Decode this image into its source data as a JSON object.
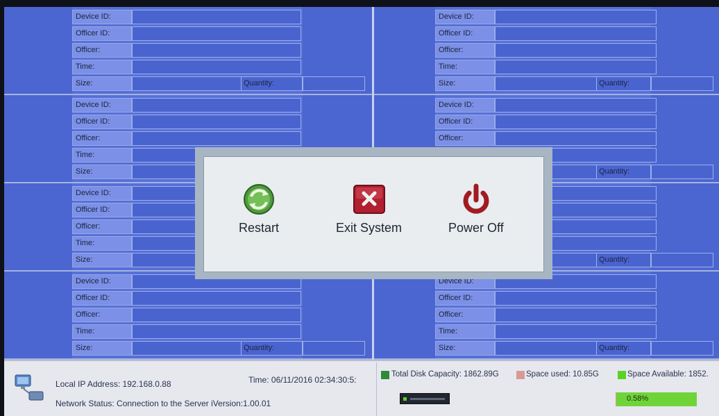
{
  "labels": {
    "device_id": "Device ID:",
    "officer_id": "Officer ID:",
    "officer": "Officer:",
    "time": "Time:",
    "size": "Size:",
    "quantity": "Quantity:"
  },
  "panels": [
    {
      "id": "slot-1"
    },
    {
      "id": "slot-2"
    },
    {
      "id": "slot-3"
    },
    {
      "id": "slot-4"
    },
    {
      "id": "slot-5"
    },
    {
      "id": "slot-6"
    },
    {
      "id": "slot-7"
    },
    {
      "id": "slot-8"
    }
  ],
  "status": {
    "ip_label": "Local IP Address:",
    "ip_value": "192.168.0.88",
    "time_label": "Time:",
    "time_value": "06/11/2016 02:34:30:5:",
    "network_label": "Network Status:",
    "network_value": "Connection to the Server i",
    "version_label": "Version:",
    "version_value": "1.00.01",
    "total_disk": "Total Disk Capacity: 1862.89G",
    "space_used": "Space used: 10.85G",
    "space_available": "Space Available: 1852.",
    "used_percent_text": "0.58%",
    "used_fraction": 0.0058
  },
  "colors": {
    "total_disk": "#2f8a3a",
    "space_used": "#d99a94",
    "space_available": "#5cd125"
  },
  "dialog": {
    "restart": "Restart",
    "exit": "Exit System",
    "power_off": "Power Off"
  },
  "icons": {
    "restart": "green-refresh-icon",
    "exit": "red-x-icon",
    "power_off": "power-icon",
    "network": "network-computer-icon"
  }
}
